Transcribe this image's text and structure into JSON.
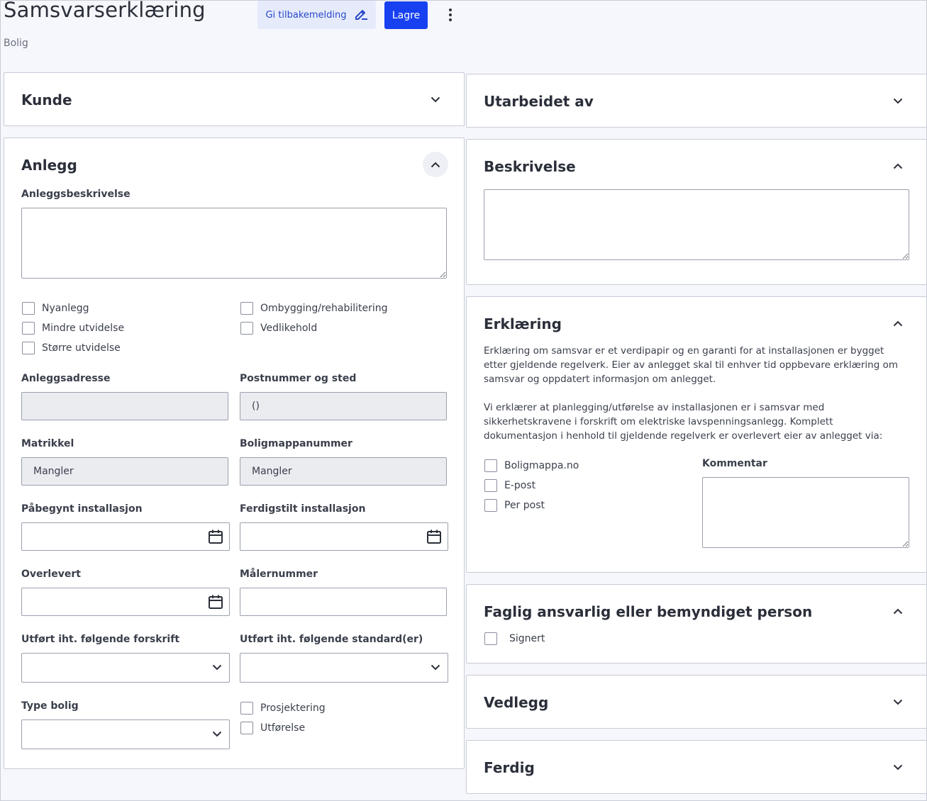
{
  "header": {
    "title": "Samsvarserklæring",
    "subtitle": "Bolig",
    "feedback_label": "Gi tilbakemelding",
    "save_label": "Lagre"
  },
  "kunde": {
    "title": "Kunde"
  },
  "anlegg": {
    "title": "Anlegg",
    "beskrivelse_label": "Anleggsbeskrivelse",
    "checkboxes": {
      "nyanlegg": "Nyanlegg",
      "mindre": "Mindre utvidelse",
      "storre": "Større utvidelse",
      "ombygging": "Ombygging/rehabilitering",
      "vedlikehold": "Vedlikehold"
    },
    "adresse_label": "Anleggsadresse",
    "adresse_value": "",
    "postnummer_label": "Postnummer og sted",
    "postnummer_value": "()",
    "matrikkel_label": "Matrikkel",
    "matrikkel_value": "Mangler",
    "boligmappe_label": "Boligmappanummer",
    "boligmappe_value": "Mangler",
    "pabegynt_label": "Påbegynt installasjon",
    "ferdigstilt_label": "Ferdigstilt installasjon",
    "overlevert_label": "Overlevert",
    "malernummer_label": "Målernummer",
    "forskrift_label": "Utført iht. følgende forskrift",
    "standard_label": "Utført iht. følgende standard(er)",
    "type_bolig_label": "Type bolig",
    "prosjektering": "Prosjektering",
    "utforelse": "Utførelse"
  },
  "utarbeidet": {
    "title": "Utarbeidet av"
  },
  "beskrivelse": {
    "title": "Beskrivelse"
  },
  "erklaring": {
    "title": "Erklæring",
    "para1": "Erklæring om samsvar er et verdipapir og en garanti for at installasjonen er bygget etter gjeldende regelverk. Eier av anlegget skal til enhver tid oppbevare erklæring om samsvar og oppdatert informasjon om anlegget.",
    "para2": "Vi erklærer at planlegging/utførelse av installasjonen er i samsvar med sikkerhetskravene i forskrift om elektriske lavspenningsanlegg. Komplett dokumentasjon i henhold til gjeldende regelverk er overlevert eier av anlegget via:",
    "options": {
      "boligmappa": "Boligmappa.no",
      "epost": "E-post",
      "perpost": "Per post"
    },
    "kommentar_label": "Kommentar"
  },
  "faglig": {
    "title": "Faglig ansvarlig eller bemyndiget person",
    "signert": "Signert"
  },
  "vedlegg": {
    "title": "Vedlegg"
  },
  "ferdig": {
    "title": "Ferdig"
  },
  "colors": {
    "primary": "#1740f0",
    "feedback_bg": "#e6ebfb",
    "feedback_text": "#2848c8",
    "readonly_bg": "#ebecf0"
  }
}
